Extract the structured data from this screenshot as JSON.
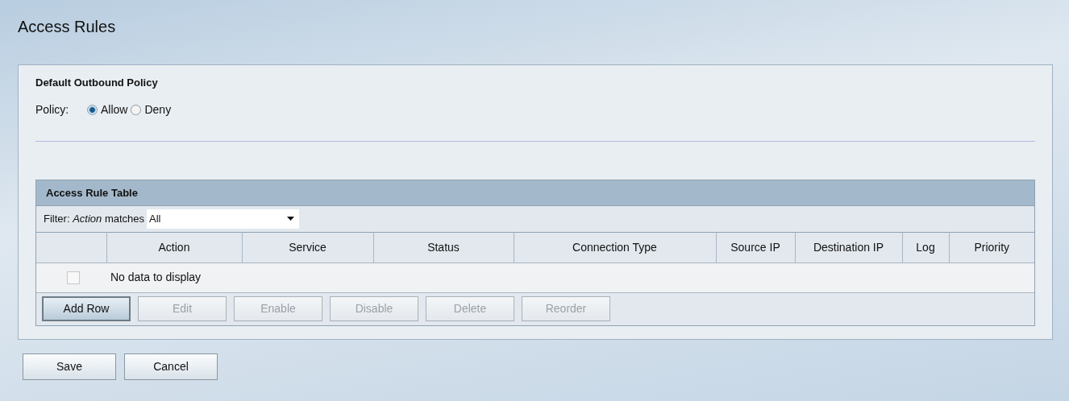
{
  "page": {
    "title": "Access Rules"
  },
  "policy_section": {
    "heading": "Default Outbound Policy",
    "label": "Policy:",
    "options": [
      {
        "label": "Allow",
        "selected": true
      },
      {
        "label": "Deny",
        "selected": false
      }
    ]
  },
  "table": {
    "title": "Access Rule Table",
    "filter_label": "Filter: *Action* matches",
    "filter_value": "All",
    "columns": [
      "",
      "Action",
      "Service",
      "Status",
      "Connection Type",
      "Source IP",
      "Destination IP",
      "Log",
      "Priority"
    ],
    "empty_row": {
      "checked": false,
      "text": "No data to display"
    },
    "buttons": [
      {
        "label": "Add Row",
        "disabled": false
      },
      {
        "label": "Edit",
        "disabled": true
      },
      {
        "label": "Enable",
        "disabled": true
      },
      {
        "label": "Disable",
        "disabled": true
      },
      {
        "label": "Delete",
        "disabled": true
      },
      {
        "label": "Reorder",
        "disabled": true
      }
    ]
  },
  "footer_buttons": [
    {
      "label": "Save",
      "disabled": false
    },
    {
      "label": "Cancel",
      "disabled": false
    }
  ]
}
